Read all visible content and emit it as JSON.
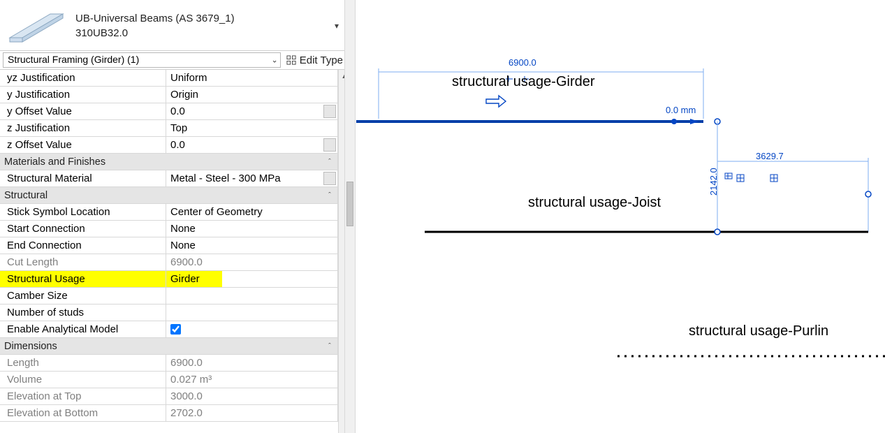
{
  "typeSelector": {
    "family": "UB-Universal Beams (AS 3679_1)",
    "type": "310UB32.0"
  },
  "filter": {
    "label": "Structural Framing (Girder) (1)",
    "editType": "Edit Type"
  },
  "groups": {
    "matFin": "Materials and Finishes",
    "structural": "Structural",
    "dimensions": "Dimensions"
  },
  "props": {
    "yz_just": {
      "name": "yz Justification",
      "value": "Uniform"
    },
    "y_just": {
      "name": "y Justification",
      "value": "Origin"
    },
    "y_off": {
      "name": "y Offset Value",
      "value": "0.0"
    },
    "z_just": {
      "name": "z Justification",
      "value": "Top"
    },
    "z_off": {
      "name": "z Offset Value",
      "value": "0.0"
    },
    "mat": {
      "name": "Structural Material",
      "value": "Metal - Steel - 300 MPa"
    },
    "stick": {
      "name": "Stick Symbol Location",
      "value": "Center of Geometry"
    },
    "start_conn": {
      "name": "Start Connection",
      "value": "None"
    },
    "end_conn": {
      "name": "End Connection",
      "value": "None"
    },
    "cut_len": {
      "name": "Cut Length",
      "value": "6900.0"
    },
    "struct_usage": {
      "name": "Structural Usage",
      "value": "Girder"
    },
    "camber": {
      "name": "Camber Size",
      "value": ""
    },
    "studs": {
      "name": "Number of studs",
      "value": ""
    },
    "analytical": {
      "name": "Enable Analytical Model",
      "value": true
    },
    "length": {
      "name": "Length",
      "value": "6900.0"
    },
    "volume": {
      "name": "Volume",
      "value": "0.027 m³"
    },
    "el_top": {
      "name": "Elevation at Top",
      "value": "3000.0"
    },
    "el_bot": {
      "name": "Elevation at Bottom",
      "value": "2702.0"
    }
  },
  "canvas": {
    "dim_top": "6900.0",
    "dim_side": "2142.0",
    "dim_right": "3629.7",
    "offset": "0.0  mm",
    "label_girder": "structural usage-Girder",
    "label_joist": "structural usage-Joist",
    "label_purlin": "structural usage-Purlin"
  }
}
